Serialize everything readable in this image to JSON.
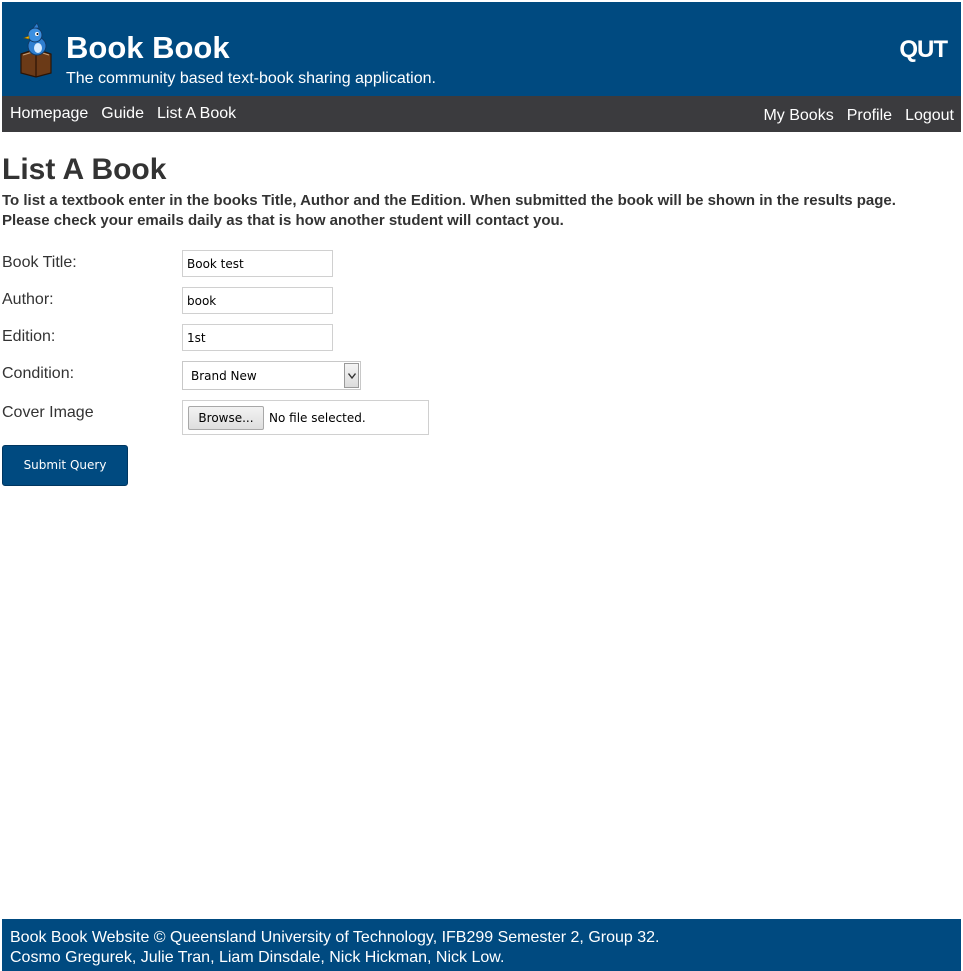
{
  "header": {
    "site_title": "Book Book",
    "tagline": "The community based text-book sharing application.",
    "university_logo": "QUT",
    "logo_icon": "bird-on-book-icon",
    "background_color": "#004a80"
  },
  "nav": {
    "left_items": [
      "Homepage",
      "Guide",
      "List A Book"
    ],
    "right_items": [
      "My Books",
      "Profile",
      "Logout"
    ],
    "background_color": "#3b3b3e"
  },
  "main": {
    "heading": "List A Book",
    "intro_line1": "To list a textbook enter in the books Title, Author and the Edition. When submitted the book will be shown in the results page.",
    "intro_line2": "Please check your emails daily as that is how another student will contact you."
  },
  "form": {
    "title_label": "Book Title:",
    "title_value": "Book test",
    "author_label": "Author:",
    "author_value": "book",
    "edition_label": "Edition:",
    "edition_value": "1st",
    "condition_label": "Condition:",
    "condition_value": "Brand New",
    "cover_label": "Cover Image",
    "browse_label": "Browse...",
    "file_status": "No file selected.",
    "submit_label": "Submit Query"
  },
  "footer": {
    "line1": "Book Book Website © Queensland University of Technology, IFB299 Semester 2, Group 32.",
    "line2": "Cosmo Gregurek, Julie Tran, Liam Dinsdale, Nick Hickman, Nick Low."
  }
}
